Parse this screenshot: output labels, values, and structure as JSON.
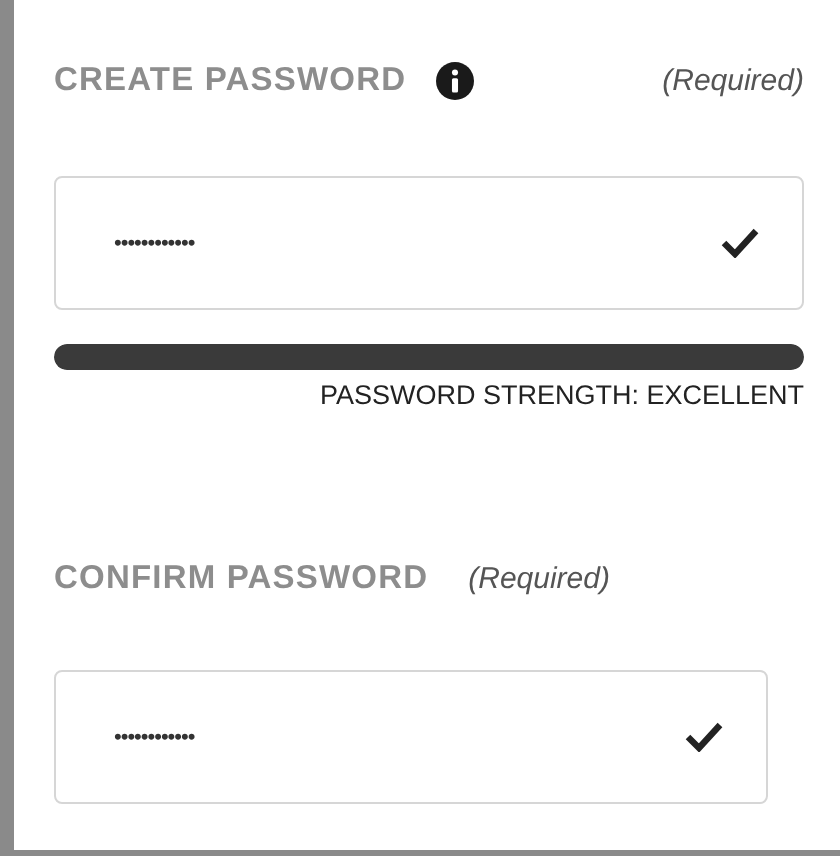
{
  "fields": [
    {
      "label": "CREATE PASSWORD",
      "info": true,
      "required_note": "(Required)",
      "value": "••••••••••••",
      "valid": true,
      "strength": {
        "level": 1,
        "caption": "PASSWORD STRENGTH: EXCELLENT"
      }
    },
    {
      "label": "CONFIRM PASSWORD",
      "info": false,
      "required_note": "(Required)",
      "value": "••••••••••••",
      "valid": true
    }
  ]
}
